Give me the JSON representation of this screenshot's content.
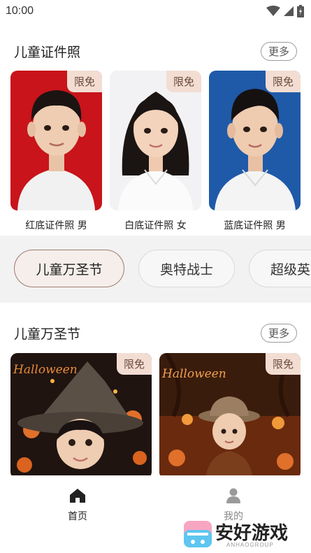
{
  "status": {
    "time": "10:00"
  },
  "id_section": {
    "title": "儿童证件照",
    "more_label": "更多",
    "cards": [
      {
        "label": "红底证件照 男",
        "badge": "限免",
        "bg": "#c8141a"
      },
      {
        "label": "白底证件照 女",
        "badge": "限免",
        "bg": "#f2f2f4"
      },
      {
        "label": "蓝底证件照 男",
        "badge": "限免",
        "bg": "#1f5aa8"
      }
    ]
  },
  "tabs": [
    "儿童万圣节",
    "奥特战士",
    "超级英"
  ],
  "halloween_section": {
    "title": "儿童万圣节",
    "more_label": "更多",
    "cards": [
      {
        "badge": "限免",
        "art_text": "Halloween"
      },
      {
        "badge": "限免",
        "art_text": "Halloween"
      }
    ]
  },
  "nav": {
    "home_label": "首页",
    "mine_label": "我的"
  },
  "watermark": {
    "brand": "安好游戏",
    "sub": "ANHAOGROUP"
  },
  "colors": {
    "badge_bg": "#f3ddd3",
    "accent": "#a17c6e",
    "strip_bg": "#f2f2f2"
  }
}
